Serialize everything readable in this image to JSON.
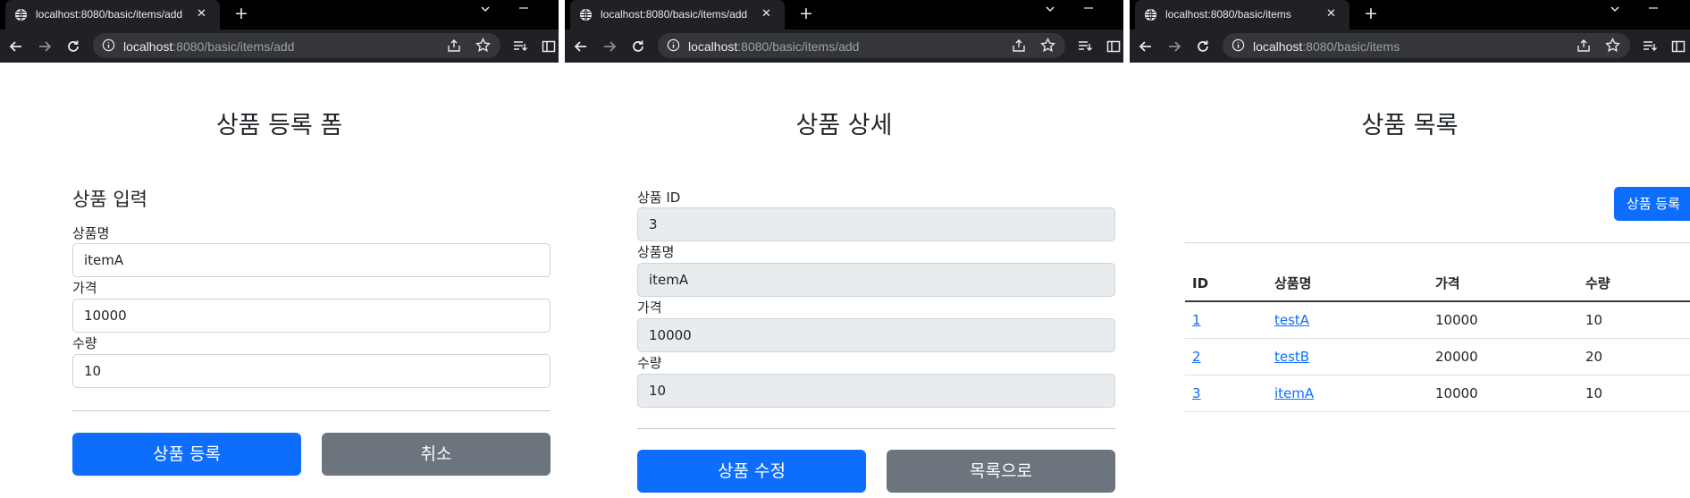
{
  "window1": {
    "tab_title": "localhost:8080/basic/items/add",
    "url_host": "localhost",
    "url_rest": ":8080/basic/items/add",
    "page_title": "상품 등록 폼",
    "section_title": "상품 입력",
    "name_label": "상품명",
    "name_value": "itemA",
    "price_label": "가격",
    "price_value": "10000",
    "quantity_label": "수량",
    "quantity_value": "10",
    "submit_label": "상품 등록",
    "cancel_label": "취소"
  },
  "window2": {
    "tab_title": "localhost:8080/basic/items/add",
    "url_host": "localhost",
    "url_rest": ":8080/basic/items/add",
    "page_title": "상품 상세",
    "id_label": "상품 ID",
    "id_value": "3",
    "name_label": "상품명",
    "name_value": "itemA",
    "price_label": "가격",
    "price_value": "10000",
    "quantity_label": "수량",
    "quantity_value": "10",
    "edit_label": "상품 수정",
    "list_label": "목록으로"
  },
  "window3": {
    "tab_title": "localhost:8080/basic/items",
    "url_host": "localhost",
    "url_rest": ":8080/basic/items",
    "page_title": "상품 목록",
    "register_label": "상품 등록",
    "columns": [
      "ID",
      "상품명",
      "가격",
      "수량"
    ],
    "rows": [
      [
        "1",
        "testA",
        "10000",
        "10"
      ],
      [
        "2",
        "testB",
        "20000",
        "20"
      ],
      [
        "3",
        "itemA",
        "10000",
        "10"
      ]
    ]
  },
  "colors": {
    "primary": "#0d6efd",
    "secondary": "#6c757d",
    "readonly_bg": "#e9ecef",
    "chrome_dark": "#202124"
  }
}
